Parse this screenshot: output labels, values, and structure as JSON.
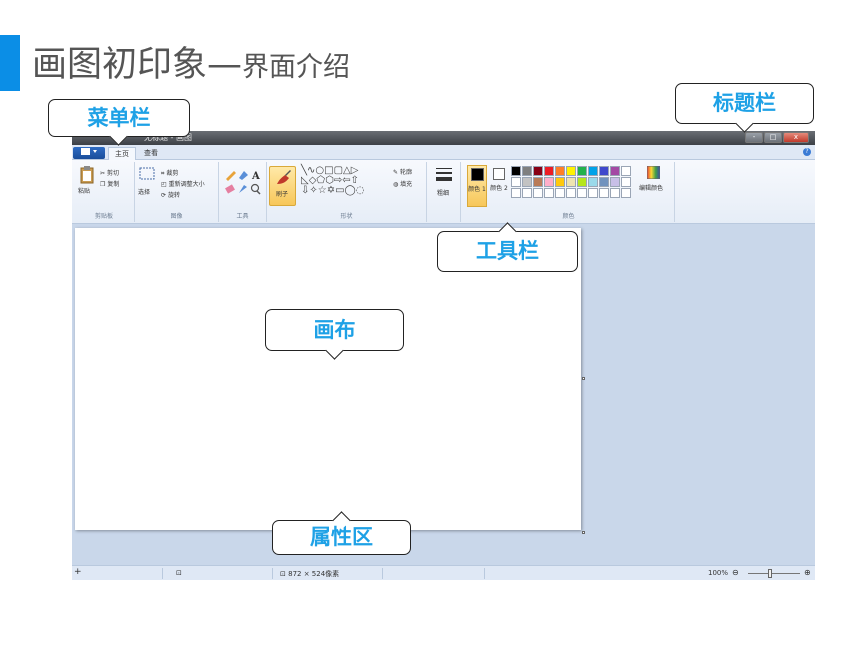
{
  "slide": {
    "title": "画图初印象",
    "dash": "—",
    "subtitle": "界面介绍",
    "accent_color": "#0b8ee6",
    "callout_color": "#1ea1e6"
  },
  "callouts": {
    "menu": "菜单栏",
    "title": "标题栏",
    "toolbar": "工具栏",
    "canvas": "画布",
    "properties": "属性区"
  },
  "window": {
    "title": "无标题 - 画图",
    "controls": [
      "-",
      "□",
      "x"
    ]
  },
  "menubar": {
    "file_icon": "paint-menu-icon",
    "tabs": [
      "主页",
      "查看"
    ],
    "help": "?"
  },
  "ribbon": {
    "clipboard": {
      "label": "剪贴板",
      "paste": "粘贴",
      "cut": "剪切",
      "copy": "复制"
    },
    "image": {
      "label": "图像",
      "select": "选择",
      "crop": "裁剪",
      "resize": "重新调整大小",
      "rotate": "旋转"
    },
    "tools": {
      "label": "工具"
    },
    "brushes": {
      "label": "刷子"
    },
    "shapes": {
      "label": "形状",
      "row1": "╲∿○□▢△▷",
      "row2": "◺◇⬠⬡⇨⇦⇧",
      "row3": "⇩✧☆✡▭◯◌",
      "outline": "轮廓",
      "fill": "填充"
    },
    "size": {
      "label": "粗细"
    },
    "colors": {
      "label": "颜色",
      "color1": "颜色 1",
      "color2": "颜色 2",
      "edit": "编辑颜色",
      "palette_row1": [
        "#000000",
        "#7f7f7f",
        "#880015",
        "#ed1c24",
        "#ff7f27",
        "#fff200",
        "#22b14c",
        "#00a2e8",
        "#3f48cc",
        "#a349a4",
        "#ffffff"
      ],
      "palette_row2": [
        "#ffffff",
        "#c3c3c3",
        "#b97a57",
        "#ffaec9",
        "#ffc90e",
        "#efe4b0",
        "#b5e61d",
        "#99d9ea",
        "#7092be",
        "#c8bfe7",
        "#ffffff"
      ],
      "palette_row3": [
        "#ffffff",
        "#ffffff",
        "#ffffff",
        "#ffffff",
        "#ffffff",
        "#ffffff",
        "#ffffff",
        "#ffffff",
        "#ffffff",
        "#ffffff",
        "#ffffff"
      ]
    }
  },
  "statusbar": {
    "plus": "+",
    "size": "872 × 524像素",
    "zoom": "100%",
    "zoom_out": "⊖",
    "zoom_in": "⊕"
  }
}
